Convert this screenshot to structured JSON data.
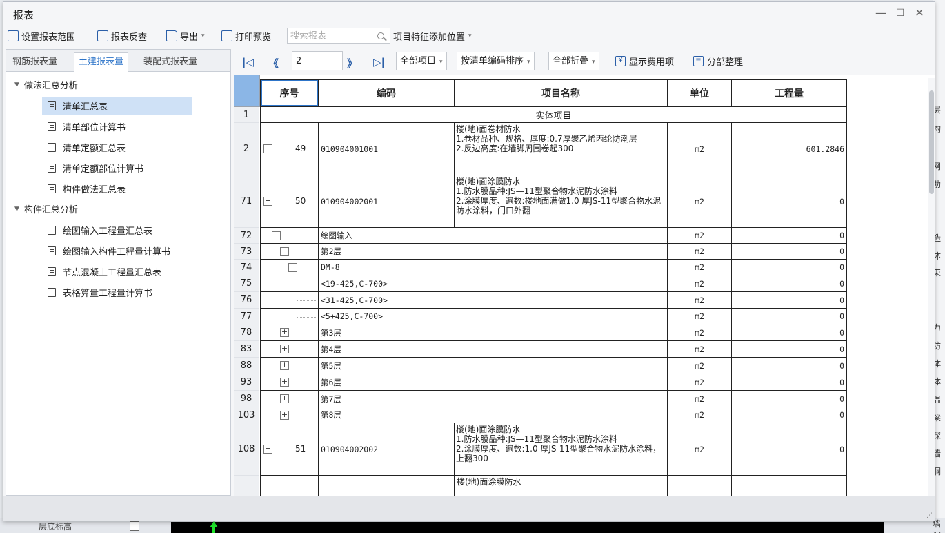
{
  "dialog": {
    "title": "报表",
    "min_glyph": "—",
    "max_glyph": "☐",
    "close_glyph": "✕"
  },
  "toolbar": {
    "set_range": "设置报表范围",
    "reverse_check": "报表反查",
    "export": "导出",
    "print_preview": "打印预览",
    "search_placeholder": "搜索报表",
    "feature_position": "项目特征添加位置"
  },
  "left_tabs": [
    "钢筋报表量",
    "土建报表量",
    "装配式报表量"
  ],
  "tree": {
    "group1": "做法汇总分析",
    "group1_items": [
      "清单汇总表",
      "清单部位计算书",
      "清单定额汇总表",
      "清单定额部位计算书",
      "构件做法汇总表"
    ],
    "group2": "构件汇总分析",
    "group2_items": [
      "绘图输入工程量汇总表",
      "绘图输入构件工程量计算书",
      "节点混凝土工程量汇总表",
      "表格算量工程量计算书"
    ]
  },
  "pager": {
    "first": "|◁",
    "prev": "《",
    "page": "2",
    "next": "》",
    "last": "▷|"
  },
  "filters": {
    "scope": "全部项目",
    "sort": "按清单编码排序",
    "fold": "全部折叠",
    "show_fee": "显示费用项",
    "tidy": "分部整理"
  },
  "table": {
    "headers": [
      "序号",
      "编码",
      "项目名称",
      "单位",
      "工程量"
    ],
    "section_title": "实体项目",
    "rows": [
      {
        "row": "1"
      },
      {
        "row": "2",
        "toggle": "+",
        "seq": "49",
        "code": "010904001001",
        "name": "楼(地)面卷材防水\n1.卷材品种、规格、厚度:0.7厚聚乙烯丙纶防潮层\n2.反边高度:在墙脚周围卷起300",
        "unit": "m2",
        "qty": "601.2846"
      },
      {
        "row": "71",
        "toggle": "−",
        "seq": "50",
        "code": "010904002001",
        "name": "楼(地)面涂膜防水\n1.防水膜品种:JS—11型聚合物水泥防水涂料\n2.涂膜厚度、遍数:楼地面满做1.0 厚JS-11型聚合物水泥防水涂料，门口外翻",
        "unit": "m2",
        "qty": "0"
      },
      {
        "row": "72",
        "toggle": "−",
        "name": "绘图输入",
        "unit": "m2",
        "qty": "0"
      },
      {
        "row": "73",
        "toggle": "−",
        "name": "第2层",
        "unit": "m2",
        "qty": "0"
      },
      {
        "row": "74",
        "toggle": "−",
        "name": "DM-8",
        "unit": "m2",
        "qty": "0"
      },
      {
        "row": "75",
        "name": "<19-425,C-700>",
        "unit": "m2",
        "qty": "0"
      },
      {
        "row": "76",
        "name": "<31-425,C-700>",
        "unit": "m2",
        "qty": "0"
      },
      {
        "row": "77",
        "name": "<5+425,C-700>",
        "unit": "m2",
        "qty": "0"
      },
      {
        "row": "78",
        "toggle": "+",
        "name": "第3层",
        "unit": "m2",
        "qty": "0"
      },
      {
        "row": "83",
        "toggle": "+",
        "name": "第4层",
        "unit": "m2",
        "qty": "0"
      },
      {
        "row": "88",
        "toggle": "+",
        "name": "第5层",
        "unit": "m2",
        "qty": "0"
      },
      {
        "row": "93",
        "toggle": "+",
        "name": "第6层",
        "unit": "m2",
        "qty": "0"
      },
      {
        "row": "98",
        "toggle": "+",
        "name": "第7层",
        "unit": "m2",
        "qty": "0"
      },
      {
        "row": "103",
        "toggle": "+",
        "name": "第8层",
        "unit": "m2",
        "qty": "0"
      },
      {
        "row": "108",
        "toggle": "+",
        "seq": "51",
        "code": "010904002002",
        "name": "楼(地)面涂膜防水\n1.防水膜品种:JS—11型聚合物水泥防水涂料\n2.涂膜厚度、遍数:1.0 厚JS-11型聚合物水泥防水涂料，上翻300",
        "unit": "m2",
        "qty": "0"
      },
      {
        "row": "",
        "name": "楼(地)面涂膜防水"
      }
    ]
  },
  "background": {
    "right_fragments": [
      "层",
      "构",
      "",
      "网",
      "助",
      "",
      "",
      "造",
      "体",
      "束",
      "",
      "力",
      "防",
      "体",
      "体",
      "温",
      "梁",
      "探",
      "墙",
      "洞"
    ],
    "bottom_label": "层底标高",
    "bottom_right": "墙洞",
    "right_bottom_top": "联"
  },
  "colors": {
    "accent": "#2e75c9",
    "corner": "#8bb6e6",
    "selected": "#cfe1f6",
    "icon_blue": "#2b5fa8"
  }
}
